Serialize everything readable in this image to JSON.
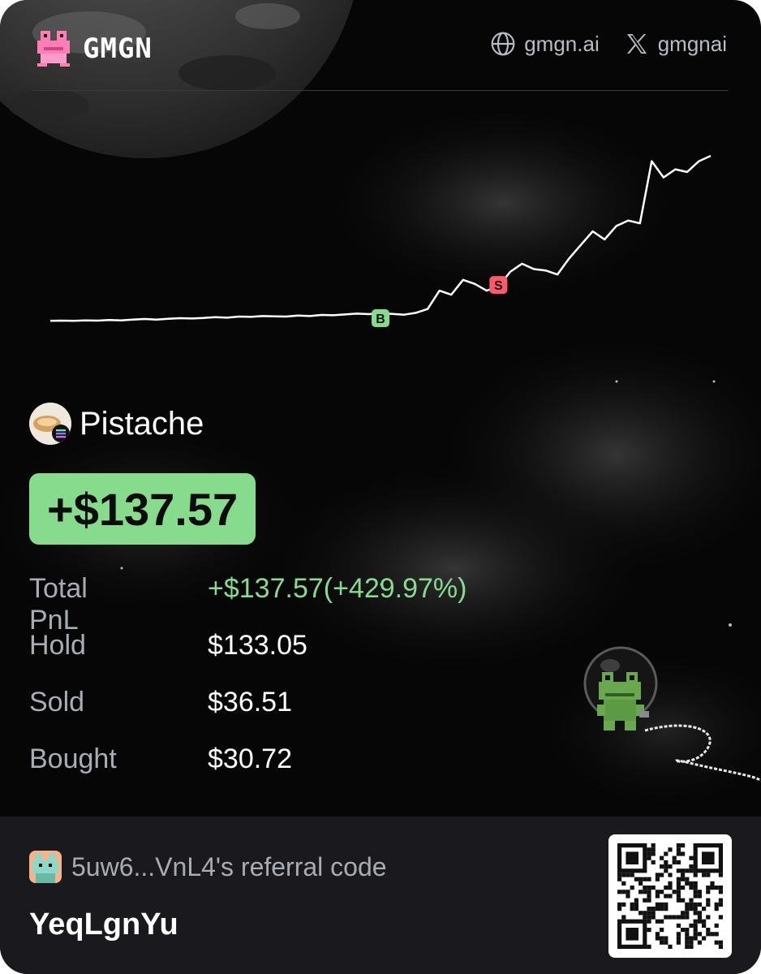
{
  "header": {
    "brand": "GMGN",
    "links": [
      {
        "icon": "globe-icon",
        "label": "gmgn.ai"
      },
      {
        "icon": "x-logo-icon",
        "label": "gmgnai"
      }
    ]
  },
  "chart_data": {
    "type": "line",
    "title": "",
    "xlabel": "",
    "ylabel": "",
    "series": [
      {
        "values": [
          0.8,
          0.9,
          0.8,
          1.0,
          0.9,
          1.1,
          1.0,
          1.3,
          1.5,
          1.3,
          1.6,
          1.8,
          1.7,
          1.9,
          2.2,
          2.0,
          2.4,
          2.3,
          2.6,
          2.5,
          2.4,
          2.8,
          2.6,
          3.0,
          2.9,
          3.2,
          3.5,
          3.3,
          3.6,
          3.4,
          3.1,
          3.8,
          5.2,
          12.0,
          10.5,
          16.0,
          14.5,
          12.0,
          13.5,
          19.0,
          22.0,
          20.0,
          19.5,
          18.0,
          24.0,
          29.0,
          34.0,
          31.0,
          36.0,
          38.0,
          37.0,
          60.0,
          54.0,
          57.0,
          56.0,
          60.0,
          62.0
        ]
      }
    ],
    "markers": [
      {
        "label": "B",
        "index": 28,
        "color": "#86dc8c"
      },
      {
        "label": "S",
        "index": 38,
        "color": "#ff5a6a"
      }
    ],
    "grid": false,
    "legend": "none",
    "line_color": "#ffffff"
  },
  "token": {
    "name": "Pistache"
  },
  "pnl": {
    "headline": "+$137.57"
  },
  "stats": [
    {
      "label": "Total PnL",
      "value": "+$137.57(+429.97%)",
      "color": "#86dc8c"
    },
    {
      "label": "Hold",
      "value": "$133.05",
      "color": "#ffffff"
    },
    {
      "label": "Sold",
      "value": "$36.51",
      "color": "#ffffff"
    },
    {
      "label": "Bought",
      "value": "$30.72",
      "color": "#ffffff"
    }
  ],
  "footer": {
    "referral_text": "5uw6...VnL4's referral code",
    "code": "YeqLgnYu"
  },
  "colors": {
    "accent_green": "#86dc8c",
    "sell_red": "#ff5a6a",
    "background": "#060606",
    "footer_bg": "#1a1a1e"
  }
}
